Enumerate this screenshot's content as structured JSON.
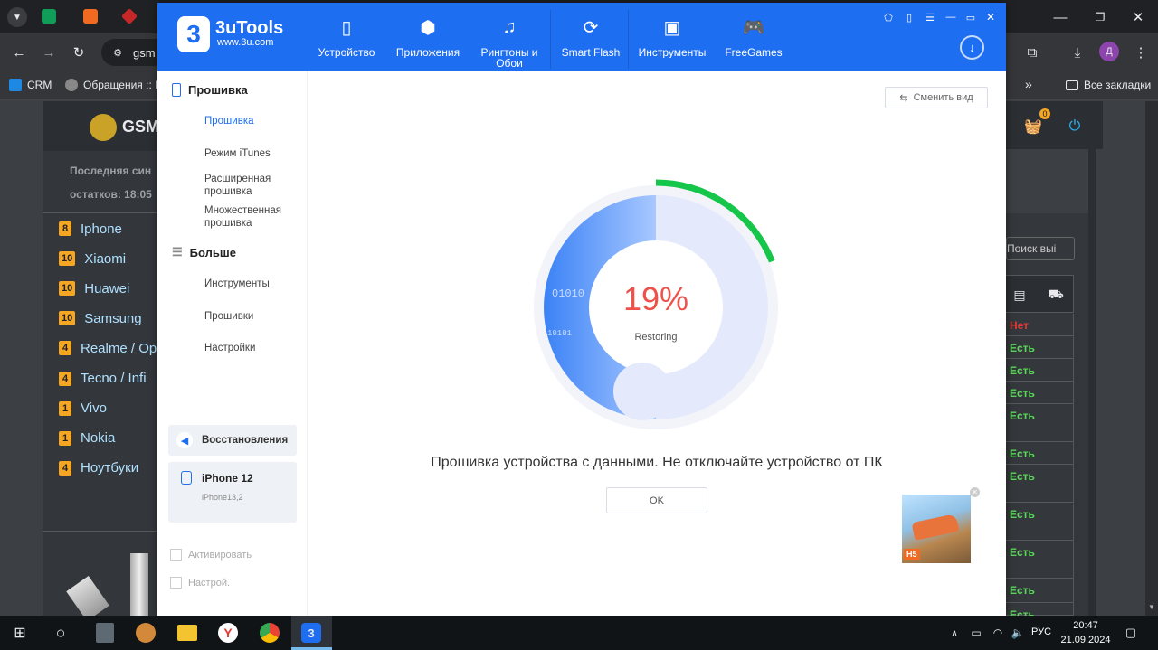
{
  "browser": {
    "address_partial": "gsm",
    "bookmarks": [
      {
        "label": "CRM"
      },
      {
        "label": "Обращения :: In"
      }
    ],
    "all_bookmarks": "Все закладки",
    "profile_initial": "Д",
    "more": "»"
  },
  "site": {
    "logo_text": "GSM",
    "sync_line1": "Последняя син",
    "sync_line2": "остатков: 18:05",
    "categories": [
      {
        "count": "8",
        "label": "Iphone"
      },
      {
        "count": "10",
        "label": "Xiaomi"
      },
      {
        "count": "10",
        "label": "Huawei"
      },
      {
        "count": "10",
        "label": "Samsung"
      },
      {
        "count": "4",
        "label": "Realme / Op"
      },
      {
        "count": "4",
        "label": "Tecno / Infi"
      },
      {
        "count": "1",
        "label": "Vivo"
      },
      {
        "count": "1",
        "label": "Nokia"
      },
      {
        "count": "4",
        "label": "Ноутбуки"
      }
    ],
    "cart_badge": "0",
    "search_placeholder": "Поиск выі",
    "stock": [
      "Нет",
      "Есть",
      "Есть",
      "Есть",
      "Есть",
      "Есть",
      "Есть",
      "Есть",
      "Есть",
      "Есть",
      "Есть"
    ],
    "colors": {
      "no": "#e53935",
      "yes": "#5cd65c"
    }
  },
  "app": {
    "logo": "3uTools",
    "site": "www.3u.com",
    "nav": [
      {
        "label": "Устройство",
        "icon": "phone-icon"
      },
      {
        "label": "Приложения",
        "icon": "cube-icon"
      },
      {
        "label": "Рингтоны и Обои",
        "icon": "music-icon"
      },
      {
        "label": "Smart Flash",
        "icon": "flash-icon"
      },
      {
        "label": "Инструменты",
        "icon": "toolbox-icon"
      },
      {
        "label": "FreeGames",
        "icon": "gamepad-icon"
      }
    ],
    "sidebar": {
      "sec1": "Прошивка",
      "items1": [
        "Прошивка",
        "Режим iTunes",
        "Расширенная прошивка",
        "Множественная прошивка"
      ],
      "sec2": "Больше",
      "items2": [
        "Инструменты",
        "Прошивки",
        "Настройки"
      ],
      "restore": "Восстановления",
      "device_name": "iPhone 12",
      "device_model": "iPhone13,2",
      "chk1": "Активировать",
      "chk2": "Настрой."
    },
    "switch_view": "Сменить вид",
    "progress": {
      "value": 0.19,
      "percent_label": "19%",
      "status": "Restoring"
    },
    "message": "Прошивка устройства с данными. Не отключайте устройство от ПК",
    "ok": "OK",
    "ad_label": "H5",
    "accent": "#1e6ef2"
  },
  "taskbar": {
    "lang": "РУС",
    "time": "20:47",
    "date": "21.09.2024"
  }
}
